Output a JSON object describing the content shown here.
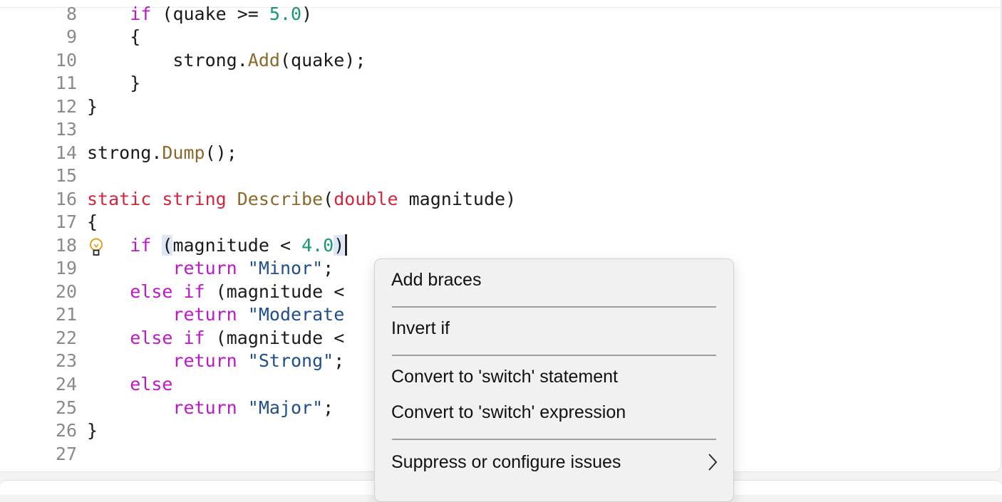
{
  "code_lines": [
    {
      "n": "8"
    },
    {
      "n": "9"
    },
    {
      "n": "10"
    },
    {
      "n": "11"
    },
    {
      "n": "12"
    },
    {
      "n": "13"
    },
    {
      "n": "14"
    },
    {
      "n": "15"
    },
    {
      "n": "16"
    },
    {
      "n": "17"
    },
    {
      "n": "18"
    },
    {
      "n": "19"
    },
    {
      "n": "20"
    },
    {
      "n": "21"
    },
    {
      "n": "22"
    },
    {
      "n": "23"
    },
    {
      "n": "24"
    },
    {
      "n": "25"
    },
    {
      "n": "26"
    },
    {
      "n": "27"
    }
  ],
  "tokens": {
    "if": "if",
    "else": "else",
    "return": "return",
    "static": "static",
    "string": "string",
    "double": "double",
    "quake": "quake",
    "strong": "strong",
    "Add": "Add",
    "Dump": "Dump",
    "Describe": "Describe",
    "magnitude": "magnitude",
    "num_5": "5.0",
    "num_4": "4.0",
    "str_minor": "\"Minor\"",
    "str_moderate": "\"Moderate",
    "str_strong": "\"Strong\"",
    "str_major": "\"Major\""
  },
  "menu": {
    "items": [
      {
        "label": "Add braces"
      },
      {
        "label": "Invert if"
      },
      {
        "label": "Convert to 'switch' statement"
      },
      {
        "label": "Convert to 'switch' expression"
      },
      {
        "label": "Suppress or configure issues"
      }
    ]
  },
  "icons": {
    "lightbulb": "lightbulb-icon",
    "chevron": "chevron-right-icon"
  },
  "colors": {
    "keyword": "#d3263c",
    "control": "#bd17c9",
    "method": "#8a6a2a",
    "number": "#159a6f",
    "string": "#1f4e8a",
    "bulb": "#e0a21a"
  }
}
